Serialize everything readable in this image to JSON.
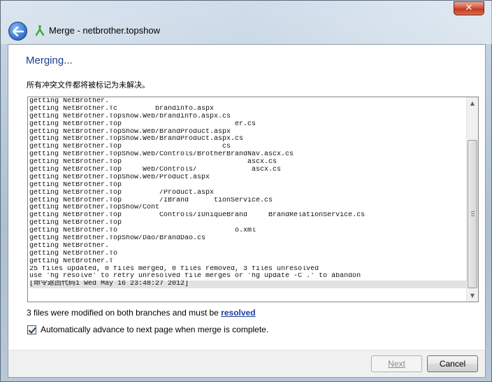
{
  "window": {
    "title": "Merge - netbrother.topshow",
    "close_glyph": "✕"
  },
  "page": {
    "heading": "Merging...",
    "note": "所有冲突文件都将被标记为未解决。"
  },
  "log": [
    "getting NetBrother.",
    "getting NetBrother.Tc         brandinfo.aspx",
    "getting NetBrother.Topshow.Web/brandinfo.aspx.cs",
    "getting NetBrother.Top                           er.cs",
    "getting NetBrother.TopShow.Web/BrandProduct.aspx",
    "getting NetBrother.TopShow.Web/BrandProduct.aspx.cs",
    "getting NetBrother.Top                        cs",
    "getting NetBrother.TopShow.Web/Controls/BrotherBrandNav.ascx.cs",
    "getting NetBrother.Top                              ascx.cs",
    "getting NetBrother.Top     Web/Controls/             ascx.cs",
    "getting NetBrother.TopShow.Web/Product.aspx",
    "getting NetBrother.Top",
    "getting NetBrother.Top         /Product.aspx",
    "getting NetBrother.Top         /IBrand      tionService.cs",
    "getting NetBrother.TopShow/Cont",
    "getting NetBrother.Top         Controls/IUniqueBrand     BrandRelationService.cs",
    "getting NetBrother.Top",
    "getting NetBrother.To                            o.xml",
    "getting NetBrother.TopShow/Dao/BrandDao.cs",
    "getting NetBrother.",
    "getting NetBrother.To",
    "getting NetBrother.T",
    "25 files updated, 0 files merged, 0 files removed, 3 files unresolved",
    "use 'hg resolve' to retry unresolved file merges or 'hg update -C .' to abandon",
    "[命令返回代码1 Wed May 16 23:48:27 2012]"
  ],
  "status": {
    "text": "3 files were modified on both branches and must be ",
    "link": "resolved"
  },
  "option": {
    "label": "Automatically advance to next page when merge is complete.",
    "checked": true
  },
  "buttons": {
    "next": "Next",
    "cancel": "Cancel"
  },
  "icons": {
    "back": "back-arrow-icon",
    "app": "merge-app-icon",
    "scroll_up": "▲",
    "scroll_down": "▼"
  }
}
